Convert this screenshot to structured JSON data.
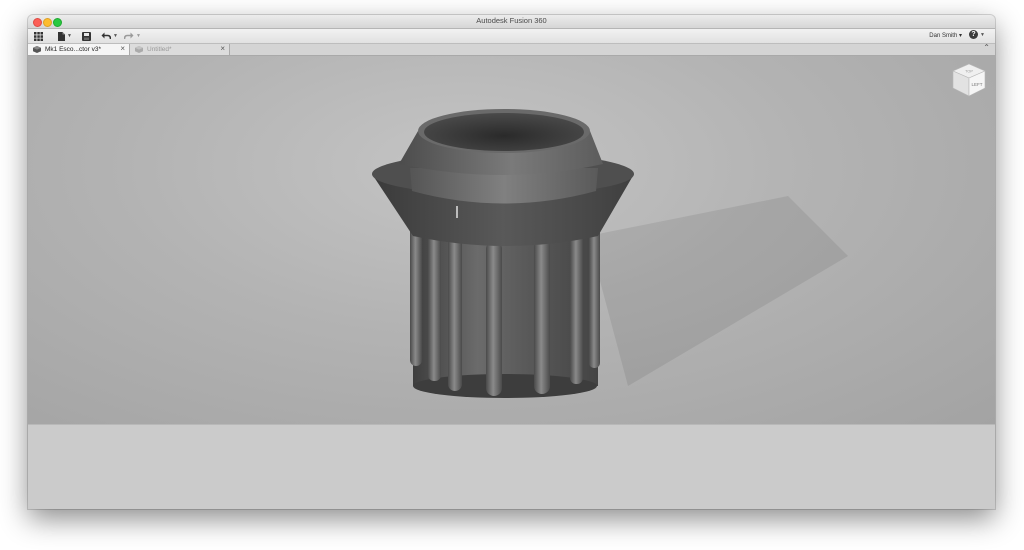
{
  "window": {
    "title": "Autodesk Fusion 360"
  },
  "toolbar": {
    "data_panel_icon": "grid-icon",
    "file_icon": "file-icon",
    "save_icon": "save-icon",
    "undo_icon": "undo-icon",
    "redo_icon": "redo-icon",
    "user_label": "Dan Smith ▾",
    "help_label": "?"
  },
  "tabs": [
    {
      "label": "Mk1 Esco...ctor v3*",
      "active": true
    },
    {
      "label": "Untitled*",
      "active": false
    }
  ],
  "viewcube": {
    "face_label": "LEFT",
    "top_label": "TOP"
  },
  "colors": {
    "viewport_bg": "#b5b5b5",
    "model": "#5a5a5a",
    "close": "#fc5f57",
    "minimize": "#fdbc2e",
    "maximize": "#29c940"
  }
}
